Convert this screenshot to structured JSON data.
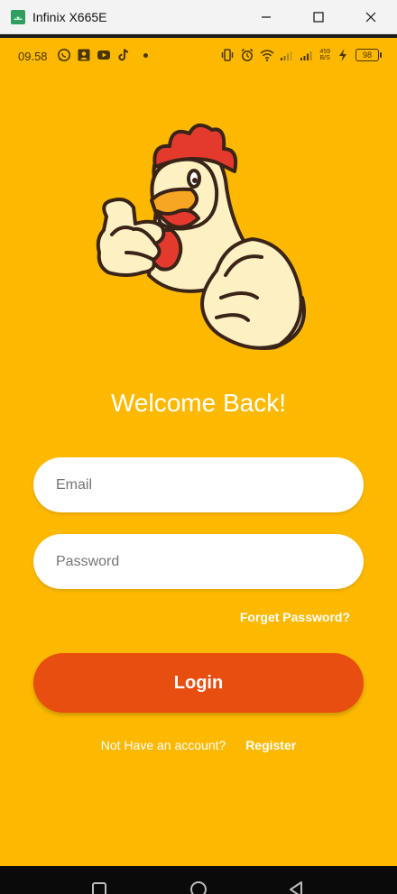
{
  "window": {
    "title": "Infinix X665E"
  },
  "status_bar": {
    "time": "09.58",
    "network_speed_value": "459",
    "network_speed_unit": "B/S",
    "battery": "98"
  },
  "login": {
    "heading": "Welcome Back!",
    "email_placeholder": "Email",
    "password_placeholder": "Password",
    "forget_password": "Forget Password?",
    "login_button": "Login",
    "no_account_text": "Not Have an account?",
    "register_link": "Register"
  },
  "colors": {
    "background": "#FDB800",
    "login_button": "#E84E0F",
    "text_on_background": "#FFFFFF"
  }
}
